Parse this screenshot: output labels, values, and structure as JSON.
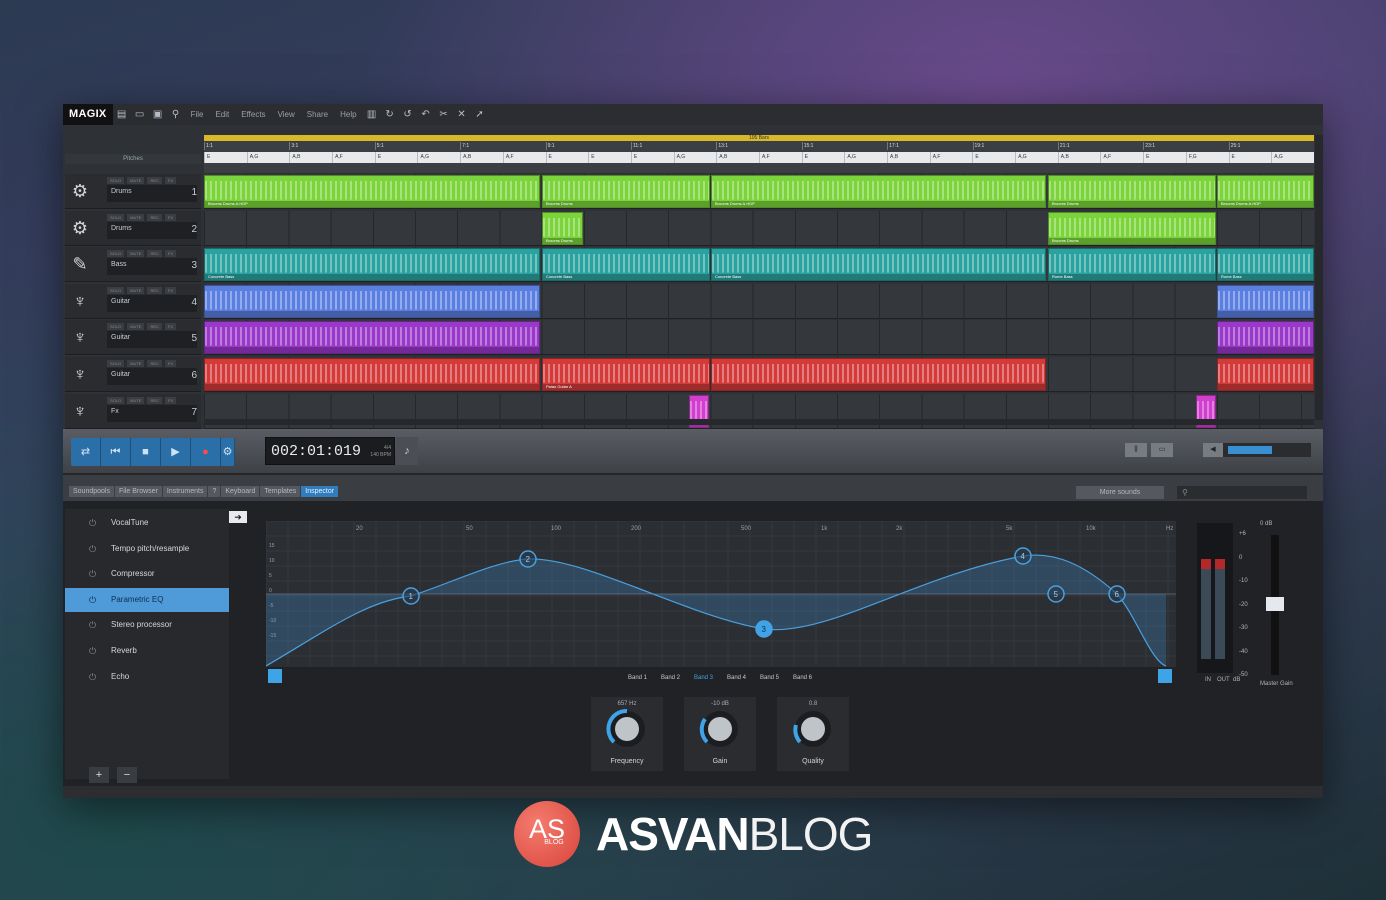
{
  "app": {
    "logo": "MAGIX"
  },
  "menu": [
    "File",
    "Edit",
    "Effects",
    "View",
    "Share",
    "Help"
  ],
  "arranger": {
    "loop_label": "105 Bars",
    "pitches_label": "Pitches",
    "bar_numbers": [
      "1:1",
      "3:1",
      "5:1",
      "7:1",
      "9:1",
      "11:1",
      "13:1",
      "15:1",
      "17:1",
      "19:1",
      "21:1",
      "23:1",
      "25:1"
    ],
    "chords": [
      "E",
      "A,G",
      "A,B",
      "A,F",
      "E",
      "A,G",
      "A,B",
      "A,F",
      "E",
      "E",
      "E",
      "A,G",
      "A,B",
      "A,F",
      "E",
      "A,G",
      "A,B",
      "A,F",
      "E",
      "A,G",
      "A,B",
      "A,F",
      "E",
      "F,G",
      "E",
      "A,G"
    ],
    "track_buttons": [
      "SOLO",
      "MUTE",
      "REC",
      "FX"
    ],
    "tracks": [
      {
        "name": "Drums",
        "num": "1",
        "icon": "drum-icon"
      },
      {
        "name": "Drums",
        "num": "2",
        "icon": "drum-icon"
      },
      {
        "name": "Bass",
        "num": "3",
        "icon": "bass-guitar-icon"
      },
      {
        "name": "Guitar",
        "num": "4",
        "icon": "guitar-icon"
      },
      {
        "name": "Guitar",
        "num": "5",
        "icon": "guitar-icon"
      },
      {
        "name": "Guitar",
        "num": "6",
        "icon": "guitar-icon"
      },
      {
        "name": "Fx",
        "num": "7",
        "icon": "guitar-icon"
      }
    ],
    "clip_labels": {
      "drums1": "Brooms Drums A.HDP",
      "drums2": "Brooms Drums",
      "bass": "Concrete Bass",
      "bass2": "Rome Bass",
      "guitar6": "Palao Guitar A"
    },
    "colors": {
      "drums": "#7bd43a",
      "bass": "#2aa3a0",
      "guitar4": "#5b7fe0",
      "guitar5": "#9a38c9",
      "guitar6": "#d43a3a",
      "fx": "#d23fcf"
    }
  },
  "transport": {
    "time": "002:01:019",
    "signature": "4/4",
    "bpm": "140 BPM"
  },
  "tabs": [
    "Soundpools",
    "File Browser",
    "Instruments",
    "?",
    "Keyboard",
    "Templates",
    "Inspector"
  ],
  "tabs_active": "Inspector",
  "more_sounds": "More sounds",
  "effects": [
    "VocalTune",
    "Tempo pitch/resample",
    "Compressor",
    "Parametric EQ",
    "Stereo processor",
    "Reverb",
    "Echo"
  ],
  "effects_active": "Parametric EQ",
  "eq": {
    "freq_labels": [
      "20",
      "50",
      "100",
      "200",
      "500",
      "1k",
      "2k",
      "5k",
      "10k",
      "Hz"
    ],
    "db_labels": [
      "15",
      "10",
      "5",
      "0",
      "-5",
      "-10",
      "-15"
    ],
    "bands": [
      "Band 1",
      "Band 2",
      "Band 3",
      "Band 4",
      "Band 5",
      "Band 6"
    ],
    "active_band": "Band 3",
    "nodes": [
      "1",
      "2",
      "3",
      "4",
      "5",
      "6"
    ]
  },
  "knobs": [
    {
      "value": "657 Hz",
      "name": "Frequency"
    },
    {
      "value": "-10 dB",
      "name": "Gain"
    },
    {
      "value": "0.8",
      "name": "Quality"
    }
  ],
  "meter": {
    "scale": [
      "+6",
      "0",
      "-10",
      "-20",
      "-30",
      "-40",
      "-50"
    ],
    "labels": [
      "IN",
      "OUT",
      "dB"
    ],
    "fader_value": "0 dB",
    "fader_label": "Master Gain"
  },
  "brand": {
    "logo_initials": "AS",
    "logo_sub": "BLOG",
    "name_bold": "ASVAN",
    "name_light": "BLOG"
  }
}
